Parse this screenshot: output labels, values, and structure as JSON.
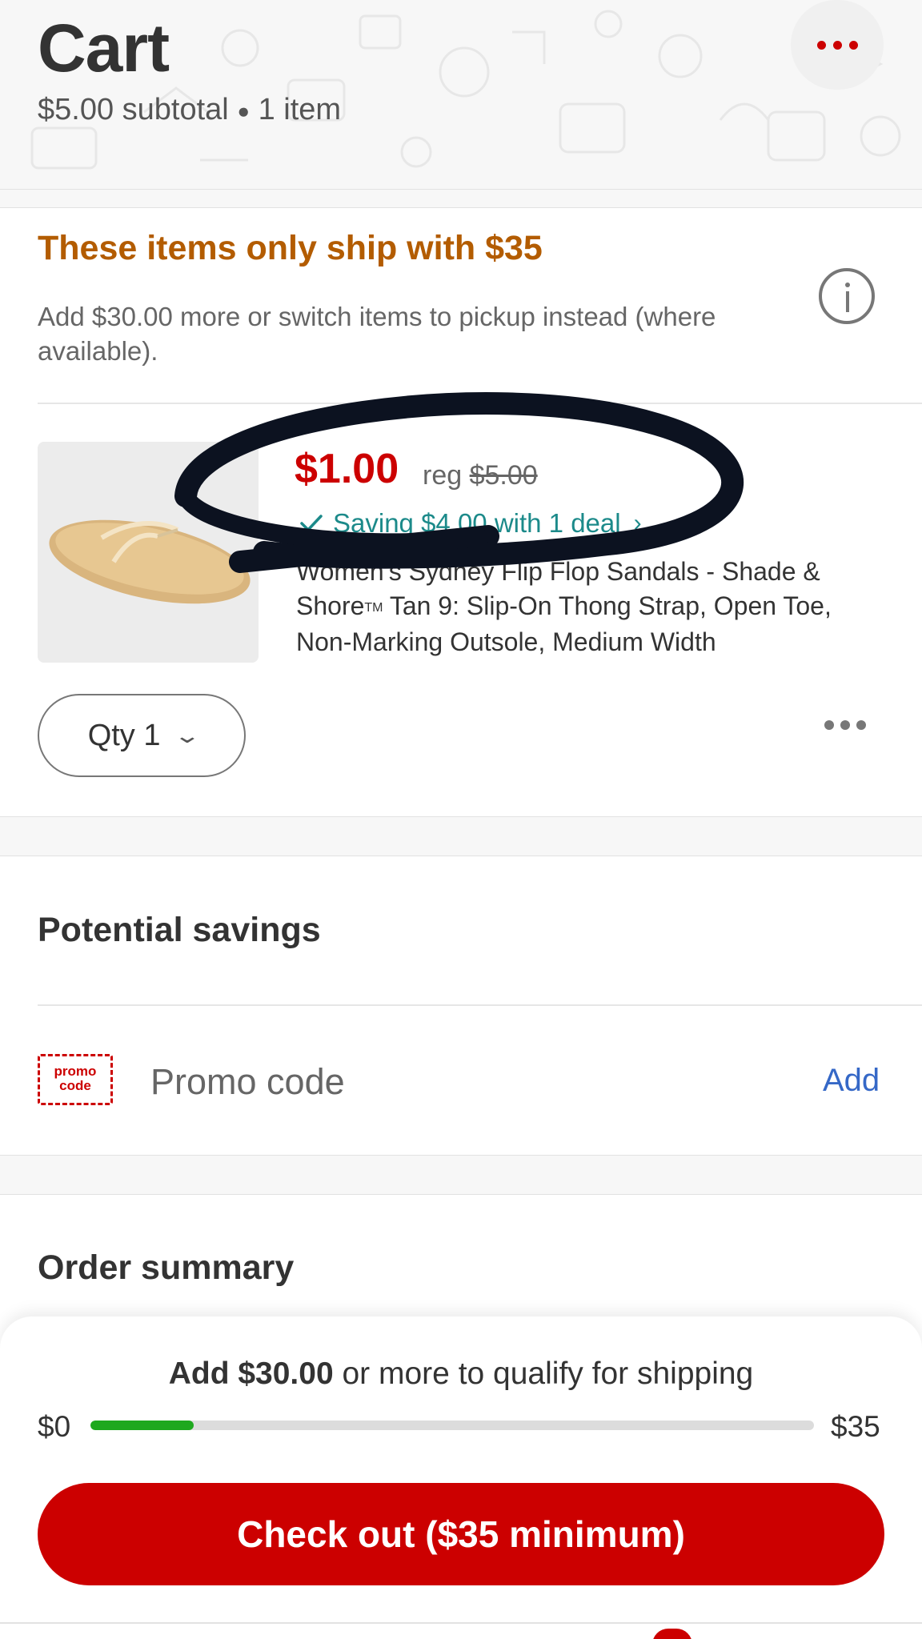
{
  "header": {
    "title": "Cart",
    "subtotal": "$5.00 subtotal",
    "bullet": "●",
    "item_count": "1 item"
  },
  "shipping_notice": {
    "heading": "These items only ship with $35",
    "description": "Add $30.00 more or switch items to pickup instead (where available).",
    "icon": "info-icon"
  },
  "cart_item": {
    "price": "$1.00",
    "reg_label": "reg",
    "reg_price": "$5.00",
    "deal_text": "Saving $4.00 with 1 deal",
    "deal_icon": "check-icon",
    "name_part1": "Women's Sydney Flip Flop Sandals - Shade & Shore",
    "name_tm": "TM",
    "name_part2": " Tan 9: Slip-On Thong Strap, Open Toe, Non-Marking Outsole, Medium Width",
    "qty_label": "Qty 1"
  },
  "savings": {
    "title": "Potential savings",
    "promo_icon_line1": "promo",
    "promo_icon_line2": "code",
    "promo_label": "Promo code",
    "add_label": "Add"
  },
  "order_summary": {
    "title": "Order summary"
  },
  "shipping_progress": {
    "message_bold": "Add $30.00",
    "message_rest": " or more to qualify for shipping",
    "min_label": "$0",
    "max_label": "$35",
    "progress_fraction": 0.143
  },
  "checkout": {
    "label": "Check out ($35 minimum)"
  },
  "colors": {
    "brand_red": "#cc0000",
    "notice_orange": "#b35c00",
    "deal_teal": "#1c8a8a",
    "link_blue": "#3568c7",
    "progress_green": "#1ea81e"
  }
}
